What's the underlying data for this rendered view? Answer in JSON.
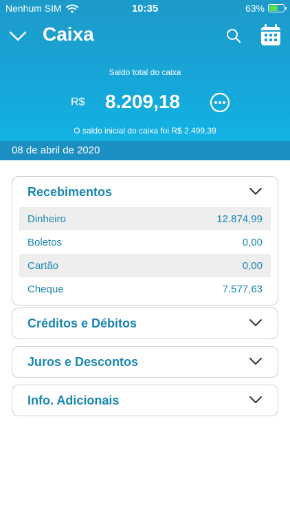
{
  "status_bar": {
    "carrier": "Nenhum SIM",
    "time": "10:35",
    "battery_text": "63%",
    "battery_level": 0.63
  },
  "nav": {
    "title": "Caixa"
  },
  "summary": {
    "saldo_label": "Saldo total do caixa",
    "currency": "R$",
    "saldo_value": "8.209,18",
    "saldo_inicial_text": "O saldo inicial do caixa foi R$ 2.499,39"
  },
  "date_bar": {
    "date": "08 de abril de 2020"
  },
  "recebimentos": {
    "title": "Recebimentos",
    "rows": [
      {
        "label": "Dinheiro",
        "value": "12.874,99"
      },
      {
        "label": "Boletos",
        "value": "0,00"
      },
      {
        "label": "Cartão",
        "value": "0,00"
      },
      {
        "label": "Cheque",
        "value": "7.577,63"
      }
    ]
  },
  "sections": {
    "creditos": "Créditos e Débitos",
    "juros": "Juros e Descontos",
    "info": "Info. Adicionais"
  },
  "colors": {
    "header_top": "#1d9ac9",
    "header_bottom": "#12b6e8",
    "date_bar": "#1b8ec2",
    "accent_text": "#1a86b2",
    "battery_green": "#59e04a"
  }
}
